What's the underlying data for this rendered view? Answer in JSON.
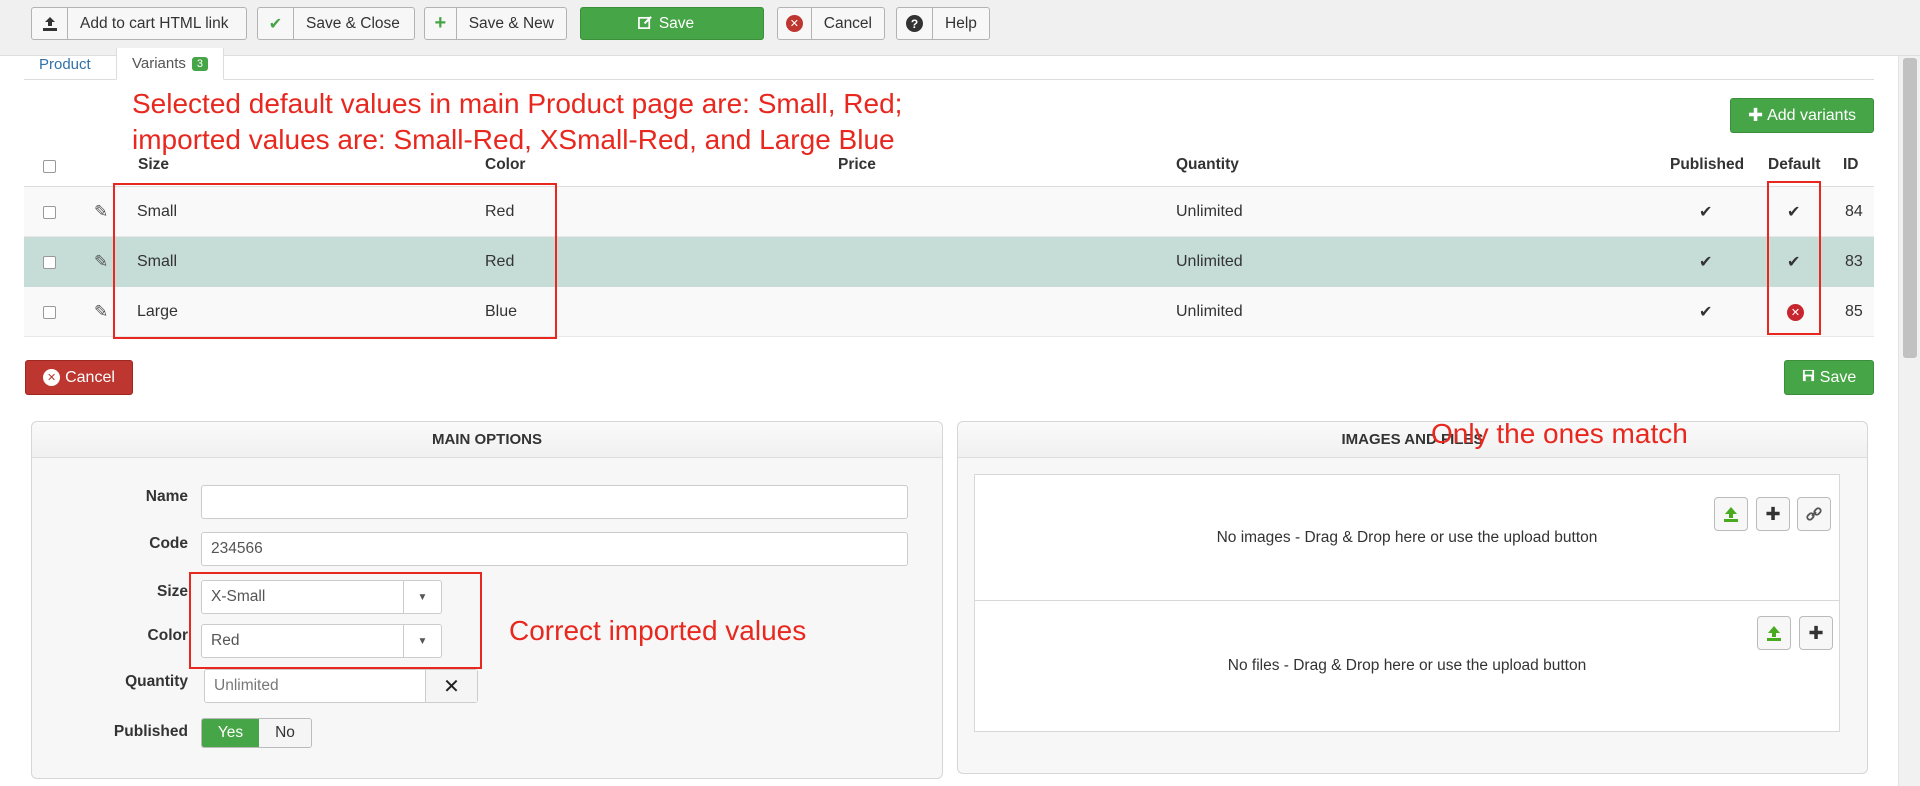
{
  "toolbar": {
    "add_to_cart": "Add to cart HTML link",
    "save_close": "Save & Close",
    "save_new": "Save & New",
    "save": "Save",
    "cancel": "Cancel",
    "help": "Help"
  },
  "tabs": {
    "product": "Product",
    "variants": "Variants",
    "variants_count": "3"
  },
  "annotations": {
    "line1": "Selected default values in main Product page are: Small, Red;",
    "line2": "imported values are: Small-Red, XSmall-Red, and Large Blue",
    "only_match": "Only the ones match",
    "correct_imported": "Correct imported values"
  },
  "table": {
    "add_variants": "Add variants",
    "headers": {
      "size": "Size",
      "color": "Color",
      "price": "Price",
      "quantity": "Quantity",
      "published": "Published",
      "default": "Default",
      "id": "ID"
    },
    "rows": [
      {
        "size": "Small",
        "color": "Red",
        "price": "",
        "quantity": "Unlimited",
        "published": true,
        "default": true,
        "id": "84"
      },
      {
        "size": "Small",
        "color": "Red",
        "price": "",
        "quantity": "Unlimited",
        "published": true,
        "default": true,
        "id": "83"
      },
      {
        "size": "Large",
        "color": "Blue",
        "price": "",
        "quantity": "Unlimited",
        "published": true,
        "default": false,
        "id": "85"
      }
    ]
  },
  "actions": {
    "cancel": "Cancel",
    "save": "Save"
  },
  "main_options": {
    "title": "MAIN OPTIONS",
    "name_label": "Name",
    "name_value": "",
    "code_label": "Code",
    "code_value": "234566",
    "size_label": "Size",
    "size_value": "X-Small",
    "color_label": "Color",
    "color_value": "Red",
    "quantity_label": "Quantity",
    "quantity_value": "Unlimited",
    "published_label": "Published",
    "yes": "Yes",
    "no": "No"
  },
  "images_files": {
    "title": "IMAGES AND FILES",
    "no_images": "No images - Drag & Drop here or use the upload button",
    "no_files": "No files - Drag & Drop here or use the upload button"
  },
  "colors": {
    "green": "#46a546",
    "red": "#bd362f",
    "annotation": "#e8281f",
    "highlight_row": "#c5dcd7"
  }
}
